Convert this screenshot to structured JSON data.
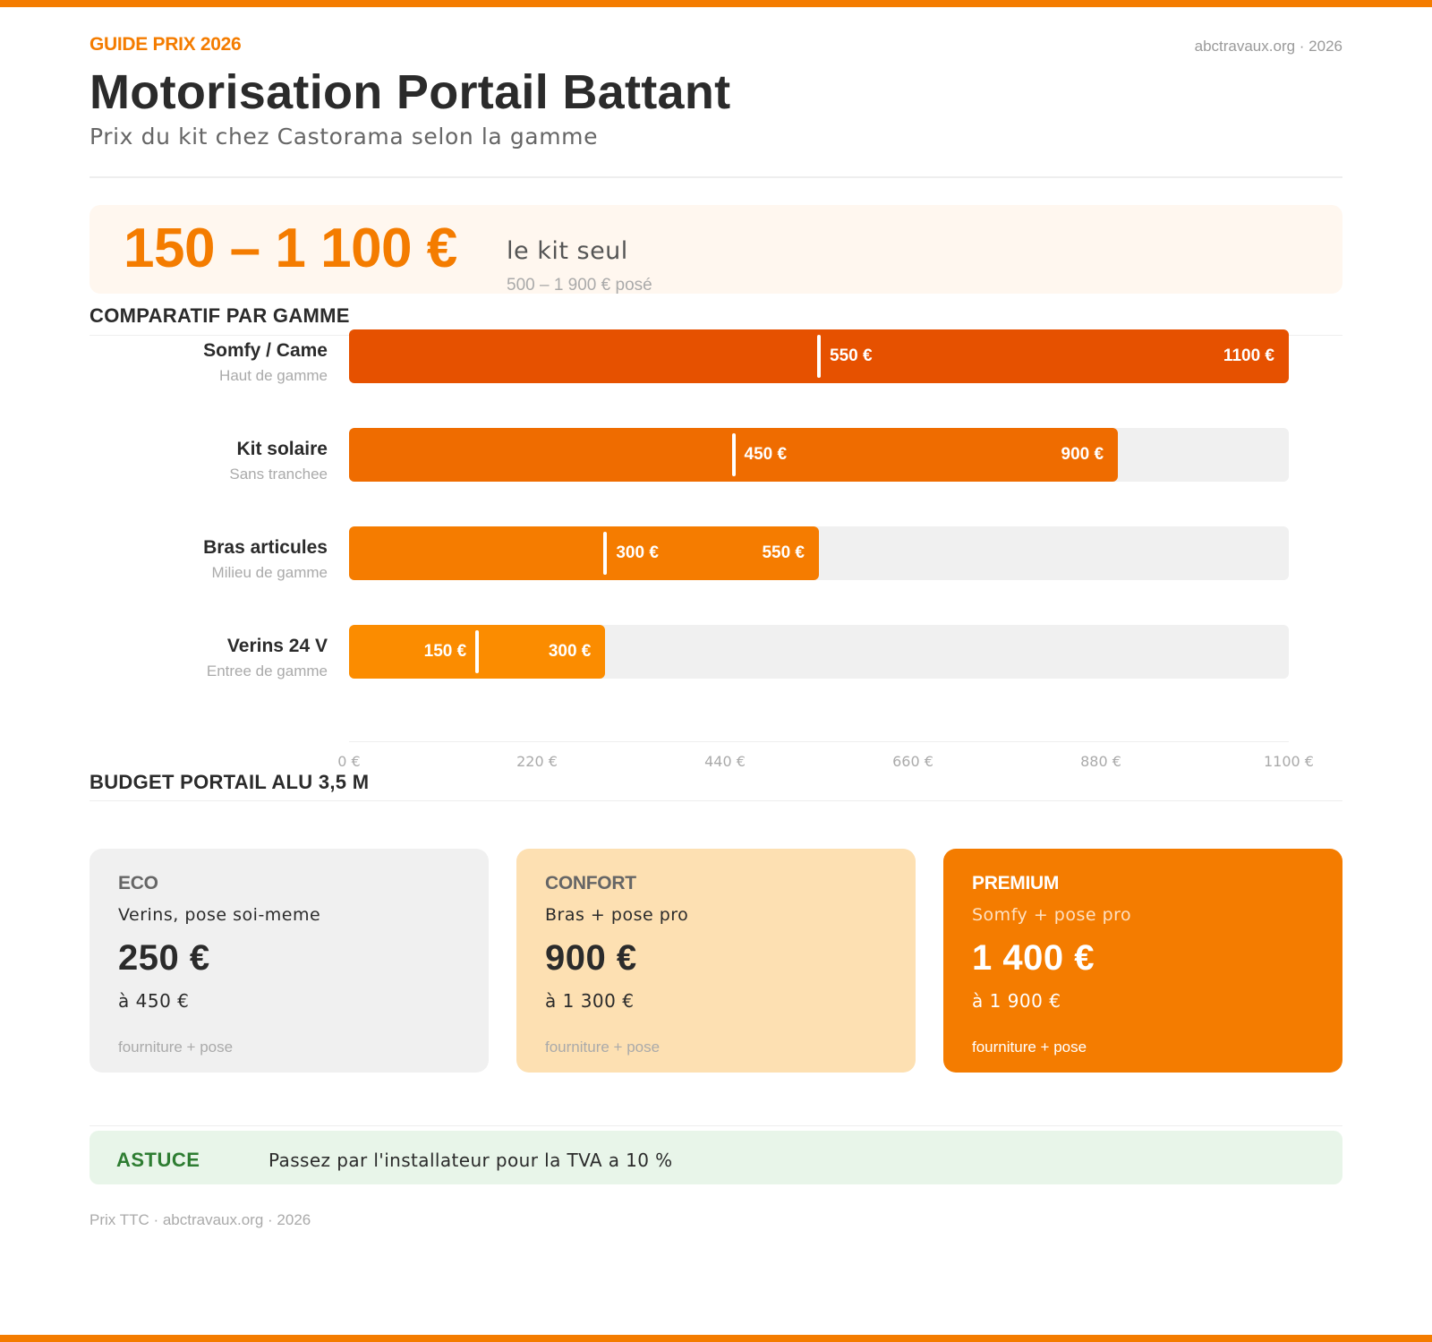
{
  "header": {
    "eyebrow": "GUIDE PRIX 2026",
    "source": "abctravaux.org · 2026",
    "title": "Motorisation Portail Battant",
    "subtitle": "Prix du kit chez Castorama selon la gamme"
  },
  "highlight": {
    "range": "150 – 1 100 €",
    "label": "le kit seul",
    "posed": "500 – 1 900 € posé"
  },
  "sections": {
    "comparison_title": "COMPARATIF PAR GAMME",
    "budget_title": "BUDGET PORTAIL ALU 3,5 M"
  },
  "chart_data": {
    "type": "bar",
    "orientation": "horizontal",
    "title": "COMPARATIF PAR GAMME",
    "categories": [
      {
        "name": "Somfy / Came",
        "sub": "Haut de gamme",
        "min": 550,
        "max": 1100,
        "min_label": "550 €",
        "max_label": "1100 €",
        "color": "#e65100"
      },
      {
        "name": "Kit solaire",
        "sub": "Sans tranchee",
        "min": 450,
        "max": 900,
        "min_label": "450 €",
        "max_label": "900 €",
        "color": "#ef6c00"
      },
      {
        "name": "Bras articules",
        "sub": "Milieu de gamme",
        "min": 300,
        "max": 550,
        "min_label": "300 €",
        "max_label": "550 €",
        "color": "#f57c00"
      },
      {
        "name": "Verins 24 V",
        "sub": "Entree de gamme",
        "min": 150,
        "max": 300,
        "min_label": "150 €",
        "max_label": "300 €",
        "color": "#fb8c00"
      }
    ],
    "xlim": [
      0,
      1100
    ],
    "ticks": [
      "0 €",
      "220 €",
      "440 €",
      "660 €",
      "880 €",
      "1100 €"
    ],
    "grid": false
  },
  "cards": [
    {
      "tier": "ECO",
      "desc": "Verins, pose soi-meme",
      "price": "250 €",
      "to": "à 450 €",
      "note": "fourniture + pose"
    },
    {
      "tier": "CONFORT",
      "desc": "Bras + pose pro",
      "price": "900 €",
      "to": "à 1 300 €",
      "note": "fourniture + pose"
    },
    {
      "tier": "PREMIUM",
      "desc": "Somfy + pose pro",
      "price": "1 400 €",
      "to": "à 1 900 €",
      "note": "fourniture + pose"
    }
  ],
  "tip": {
    "label": "ASTUCE",
    "text": "Passez par l'installateur pour la TVA a 10 %"
  },
  "footer": "Prix TTC · abctravaux.org · 2026",
  "colors": {
    "accent": "#f47c00",
    "card_eco_bg": "#f0f0f0",
    "card_confort_bg": "#fde0b2",
    "card_premium_bg": "#f47c00",
    "tip_bg": "#e8f5e9",
    "tip_label": "#2e7d32"
  }
}
